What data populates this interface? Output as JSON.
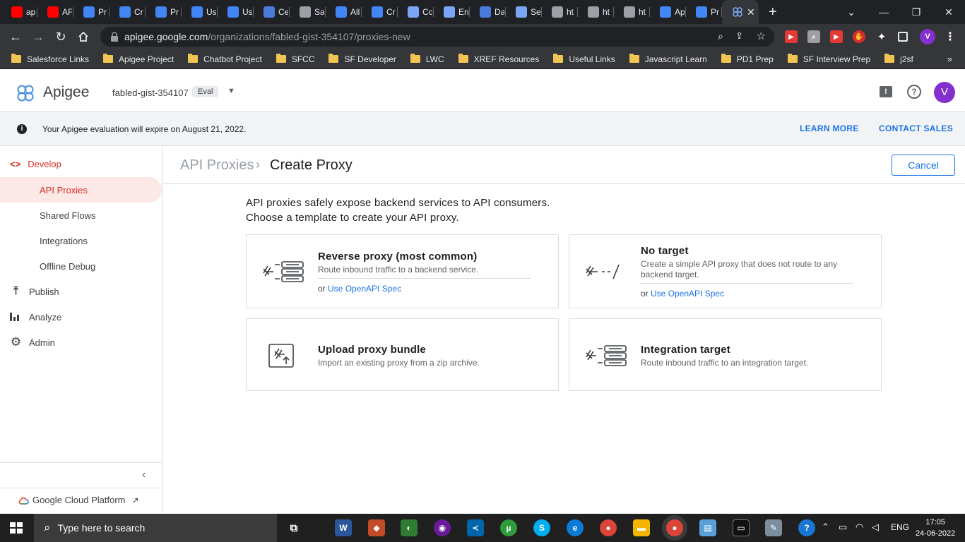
{
  "browser": {
    "tabs": [
      {
        "title": "ap",
        "icon": "youtube-icon",
        "color": "#ff0000"
      },
      {
        "title": "AF",
        "icon": "youtube-icon",
        "color": "#ff0000"
      },
      {
        "title": "Pr",
        "icon": "google-cloud-icon",
        "color": "#4285f4"
      },
      {
        "title": "Cr",
        "icon": "google-cloud-icon",
        "color": "#4285f4"
      },
      {
        "title": "Pr",
        "icon": "google-cloud-icon",
        "color": "#4285f4"
      },
      {
        "title": "Us",
        "icon": "google-cloud-icon",
        "color": "#4285f4"
      },
      {
        "title": "Us",
        "icon": "google-cloud-icon",
        "color": "#4285f4"
      },
      {
        "title": "Ce",
        "icon": "sitemap-icon",
        "color": "#4a7bd9"
      },
      {
        "title": "Sa",
        "icon": "globe-icon",
        "color": "#9aa0a6"
      },
      {
        "title": "All",
        "icon": "google-cloud-icon",
        "color": "#4285f4"
      },
      {
        "title": "Cr",
        "icon": "google-cloud-icon",
        "color": "#4285f4"
      },
      {
        "title": "Cc",
        "icon": "apigee-icon",
        "color": "#7aa7f5"
      },
      {
        "title": "En",
        "icon": "apigee-icon",
        "color": "#7aa7f5"
      },
      {
        "title": "Da",
        "icon": "dashboard-icon",
        "color": "#4a7bd9"
      },
      {
        "title": "Se",
        "icon": "apigee-icon",
        "color": "#7aa7f5"
      },
      {
        "title": "ht",
        "icon": "globe-icon",
        "color": "#9aa0a6"
      },
      {
        "title": "ht",
        "icon": "globe-icon",
        "color": "#9aa0a6"
      },
      {
        "title": "ht",
        "icon": "globe-icon",
        "color": "#9aa0a6"
      },
      {
        "title": "Ap",
        "icon": "docs-icon",
        "color": "#4285f4"
      },
      {
        "title": "Pr",
        "icon": "docs-icon",
        "color": "#4285f4"
      }
    ],
    "active_tab_icon": "apigee-icon",
    "url_host": "apigee.google.com",
    "url_path": "/organizations/fabled-gist-354107/proxies-new",
    "profile_initial": "V",
    "bookmarks": [
      "Salesforce Links",
      "Apigee Project",
      "Chatbot Project",
      "SFCC",
      "SF Developer",
      "LWC",
      "XREF Resources",
      "Useful Links",
      "Javascript Learn",
      "PD1 Prep",
      "SF Interview Prep",
      "j2sf"
    ],
    "bookmarks_more": "»"
  },
  "app": {
    "name": "Apigee",
    "org": "fabled-gist-354107",
    "org_badge": "Eval",
    "user_initial": "V",
    "accent": "#8430ce"
  },
  "banner": {
    "text": "Your Apigee evaluation will expire on August 21, 2022.",
    "learn_more": "LEARN MORE",
    "contact_sales": "CONTACT SALES"
  },
  "sidebar": {
    "develop": "Develop",
    "items": [
      "API Proxies",
      "Shared Flows",
      "Integrations",
      "Offline Debug"
    ],
    "publish": "Publish",
    "analyze": "Analyze",
    "admin": "Admin",
    "footer": "Google Cloud Platform"
  },
  "main": {
    "breadcrumb_parent": "API Proxies",
    "page_title": "Create Proxy",
    "cancel": "Cancel",
    "intro1": "API proxies safely expose backend services to API consumers.",
    "intro2": "Choose a template to create your API proxy.",
    "cards": {
      "reverse": {
        "title": "Reverse proxy (most common)",
        "desc": "Route inbound traffic to a backend service.",
        "or": "or",
        "link": "Use OpenAPI Spec"
      },
      "notarget": {
        "title": "No target",
        "desc": "Create a simple API proxy that does not route to any backend target.",
        "or": "or",
        "link": "Use OpenAPI Spec"
      },
      "upload": {
        "title": "Upload proxy bundle",
        "desc": "Import an existing proxy from a zip archive."
      },
      "integration": {
        "title": "Integration target",
        "desc": "Route inbound traffic to an integration target."
      }
    }
  },
  "taskbar": {
    "search_placeholder": "Type here to search",
    "lang": "ENG",
    "time": "17:05",
    "date": "24-06-2022"
  }
}
